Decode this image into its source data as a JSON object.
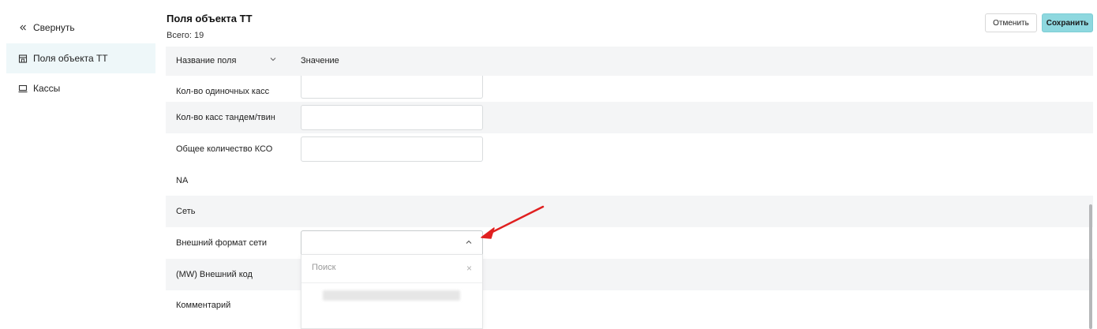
{
  "sidebar": {
    "collapse_label": "Свернуть",
    "items": [
      {
        "label": "Поля объекта ТТ",
        "icon": "store-icon",
        "active": true
      },
      {
        "label": "Кассы",
        "icon": "cash-register-icon",
        "active": false
      }
    ]
  },
  "header": {
    "title": "Поля объекта ТТ",
    "count": "Всего: 19"
  },
  "actions": {
    "cancel_label": "Отменить",
    "save_label": "Сохранить"
  },
  "table": {
    "columns": [
      "Название поля",
      "Значение"
    ],
    "rows": [
      {
        "label": "Кол-во одиночных касс",
        "value": ""
      },
      {
        "label": "Кол-во касс тандем/твин",
        "value": ""
      },
      {
        "label": "Общее количество КСО",
        "value": ""
      },
      {
        "label": "NA"
      },
      {
        "label": "Сеть"
      },
      {
        "label": "Внешний формат сети",
        "value": ""
      },
      {
        "label": "(MW) Внешний код"
      },
      {
        "label": "Комментарий"
      }
    ]
  },
  "dropdown": {
    "search_placeholder": "Поиск"
  },
  "colors": {
    "accent": "#8ed8df",
    "active_bg": "#eef7f9",
    "row_alt": "#f4f5f6",
    "annotation_arrow": "#e02020"
  }
}
